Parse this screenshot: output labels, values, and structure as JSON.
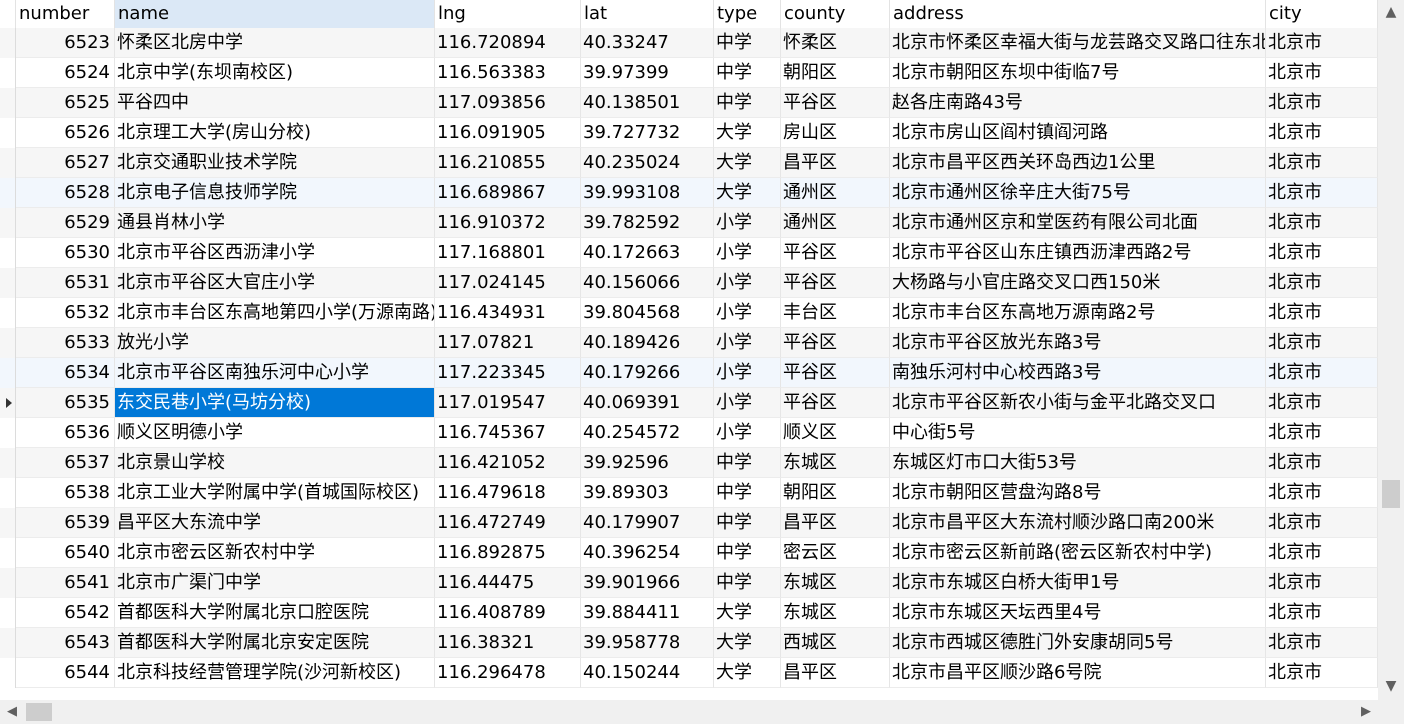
{
  "columns": [
    "number",
    "name",
    "lng",
    "lat",
    "type",
    "county",
    "address",
    "city"
  ],
  "rows": [
    [
      "6523",
      "怀柔区北房中学",
      "116.720894",
      "40.33247",
      "中学",
      "怀柔区",
      "北京市怀柔区幸福大街与龙芸路交叉路口往东北",
      "北京市"
    ],
    [
      "6524",
      "北京中学(东坝南校区)",
      "116.563383",
      "39.97399",
      "中学",
      "朝阳区",
      "北京市朝阳区东坝中街临7号",
      "北京市"
    ],
    [
      "6525",
      "平谷四中",
      "117.093856",
      "40.138501",
      "中学",
      "平谷区",
      "赵各庄南路43号",
      "北京市"
    ],
    [
      "6526",
      "北京理工大学(房山分校)",
      "116.091905",
      "39.727732",
      "大学",
      "房山区",
      "北京市房山区阎村镇阎河路",
      "北京市"
    ],
    [
      "6527",
      "北京交通职业技术学院",
      "116.210855",
      "40.235024",
      "大学",
      "昌平区",
      "北京市昌平区西关环岛西边1公里",
      "北京市"
    ],
    [
      "6528",
      "北京电子信息技师学院",
      "116.689867",
      "39.993108",
      "大学",
      "通州区",
      "北京市通州区徐辛庄大街75号",
      "北京市"
    ],
    [
      "6529",
      "通县肖林小学",
      "116.910372",
      "39.782592",
      "小学",
      "通州区",
      "北京市通州区京和堂医药有限公司北面",
      "北京市"
    ],
    [
      "6530",
      "北京市平谷区西沥津小学",
      "117.168801",
      "40.172663",
      "小学",
      "平谷区",
      "北京市平谷区山东庄镇西沥津西路2号",
      "北京市"
    ],
    [
      "6531",
      "北京市平谷区大官庄小学",
      "117.024145",
      "40.156066",
      "小学",
      "平谷区",
      "大杨路与小官庄路交叉口西150米",
      "北京市"
    ],
    [
      "6532",
      "北京市丰台区东高地第四小学(万源南路)",
      "116.434931",
      "39.804568",
      "小学",
      "丰台区",
      "北京市丰台区东高地万源南路2号",
      "北京市"
    ],
    [
      "6533",
      "放光小学",
      "117.07821",
      "40.189426",
      "小学",
      "平谷区",
      "北京市平谷区放光东路3号",
      "北京市"
    ],
    [
      "6534",
      "北京市平谷区南独乐河中心小学",
      "117.223345",
      "40.179266",
      "小学",
      "平谷区",
      "南独乐河村中心校西路3号",
      "北京市"
    ],
    [
      "6535",
      "东交民巷小学(马坊分校)",
      "117.019547",
      "40.069391",
      "小学",
      "平谷区",
      "北京市平谷区新农小街与金平北路交叉口",
      "北京市"
    ],
    [
      "6536",
      "顺义区明德小学",
      "116.745367",
      "40.254572",
      "小学",
      "顺义区",
      "中心街5号",
      "北京市"
    ],
    [
      "6537",
      "北京景山学校",
      "116.421052",
      "39.92596",
      "中学",
      "东城区",
      "东城区灯市口大街53号",
      "北京市"
    ],
    [
      "6538",
      "北京工业大学附属中学(首城国际校区)",
      "116.479618",
      "39.89303",
      "中学",
      "朝阳区",
      "北京市朝阳区营盘沟路8号",
      "北京市"
    ],
    [
      "6539",
      "昌平区大东流中学",
      "116.472749",
      "40.179907",
      "中学",
      "昌平区",
      "北京市昌平区大东流村顺沙路口南200米",
      "北京市"
    ],
    [
      "6540",
      "北京市密云区新农村中学",
      "116.892875",
      "40.396254",
      "中学",
      "密云区",
      "北京市密云区新前路(密云区新农村中学)",
      "北京市"
    ],
    [
      "6541",
      "北京市广渠门中学",
      "116.44475",
      "39.901966",
      "中学",
      "东城区",
      "北京市东城区白桥大街甲1号",
      "北京市"
    ],
    [
      "6542",
      "首都医科大学附属北京口腔医院",
      "116.408789",
      "39.884411",
      "大学",
      "东城区",
      "北京市东城区天坛西里4号",
      "北京市"
    ],
    [
      "6543",
      "首都医科大学附属北京安定医院",
      "116.38321",
      "39.958778",
      "大学",
      "西城区",
      "北京市西城区德胜门外安康胡同5号",
      "北京市"
    ],
    [
      "6544",
      "北京科技经营管理学院(沙河新校区)",
      "116.296478",
      "40.150244",
      "大学",
      "昌平区",
      "北京市昌平区顺沙路6号院",
      "北京市"
    ]
  ],
  "selected_row_index": 12,
  "selected_column": "name",
  "icons": {
    "scroll_up": "▲",
    "scroll_down": "▼",
    "scroll_left": "◀",
    "scroll_right": "▶"
  },
  "colors": {
    "selection": "#0078d7",
    "header_selected": "#dbe8f6"
  }
}
